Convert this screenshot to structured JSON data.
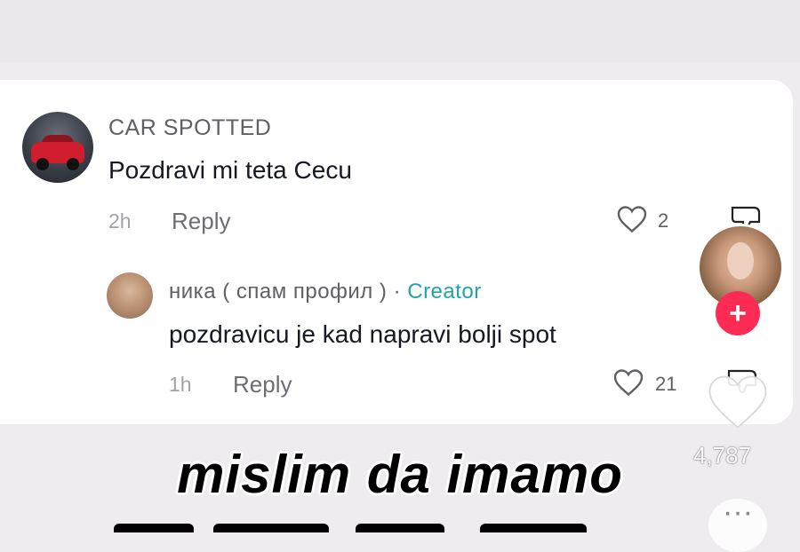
{
  "comments": [
    {
      "username": "CAR SPOTTED",
      "text": "Pozdravi mi teta Cecu",
      "time": "2h",
      "reply_label": "Reply",
      "likes": "2"
    }
  ],
  "reply": {
    "username": "ника ( спам профил )",
    "separator": "·",
    "badge": "Creator",
    "text": "pozdravicu je kad napravi bolji spot",
    "time": "1h",
    "reply_label": "Reply",
    "likes": "21"
  },
  "sidebar": {
    "like_count": "4,787",
    "follow_symbol": "+",
    "more_symbol": "···"
  },
  "caption": {
    "line1": "mislim da imamo"
  },
  "colors": {
    "creator_badge": "#20a4a9",
    "follow_button": "#fe2c55",
    "text_primary": "#161823"
  },
  "icons": [
    "heart-icon",
    "dislike-icon",
    "plus-icon",
    "more-icon"
  ]
}
